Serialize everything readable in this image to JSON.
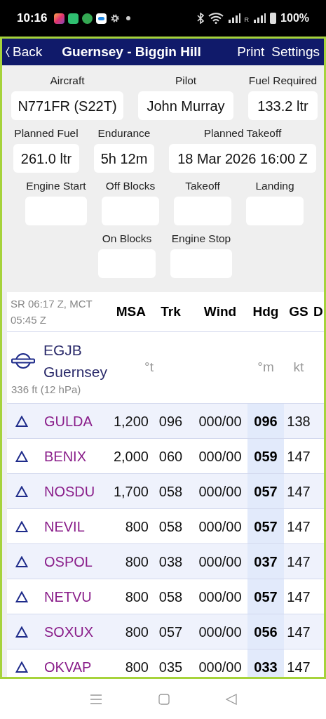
{
  "status_bar": {
    "time": "10:16",
    "roaming": "R",
    "battery": "100%"
  },
  "nav": {
    "back": "Back",
    "title": "Guernsey - Biggin Hill",
    "actions": [
      "Print",
      "Settings"
    ]
  },
  "field_rows": [
    [
      {
        "label": "Aircraft",
        "value": "N771FR (S22T)"
      },
      {
        "label": "Pilot",
        "value": "John Murray"
      },
      {
        "label": "Fuel Required",
        "value": "133.2 ltr"
      }
    ],
    [
      {
        "label": "Planned Fuel",
        "value": "261.0 ltr"
      },
      {
        "label": "Endurance",
        "value": "5h 12m"
      },
      {
        "label": "Planned Takeoff",
        "value": "18 Mar 2026 16:00 Z"
      }
    ],
    [
      {
        "label": "Engine Start"
      },
      {
        "label": "Off Blocks"
      },
      {
        "label": "Takeoff"
      },
      {
        "label": "Landing"
      }
    ],
    [
      {
        "label": "On Blocks"
      },
      {
        "label": "Engine Stop"
      }
    ]
  ],
  "table": {
    "info": "SR 06:17 Z, MCT 05:45 Z",
    "columns": [
      "MSA",
      "Trk",
      "Wind",
      "Hdg",
      "GS",
      "D"
    ],
    "departure": {
      "ident": "EGJB",
      "name": "Guernsey",
      "elevation": "336 ft (12 hPa)",
      "trk_unit": "°t",
      "hdg_unit": "°m",
      "gs_unit": "kt"
    },
    "rows": [
      {
        "name": "GULDA",
        "msa": "1,200",
        "trk": "096",
        "wind": "000/00",
        "hdg": "096",
        "gs": "138"
      },
      {
        "name": "BENIX",
        "msa": "2,000",
        "trk": "060",
        "wind": "000/00",
        "hdg": "059",
        "gs": "147"
      },
      {
        "name": "NOSDU",
        "msa": "1,700",
        "trk": "058",
        "wind": "000/00",
        "hdg": "057",
        "gs": "147"
      },
      {
        "name": "NEVIL",
        "msa": "800",
        "trk": "058",
        "wind": "000/00",
        "hdg": "057",
        "gs": "147"
      },
      {
        "name": "OSPOL",
        "msa": "800",
        "trk": "038",
        "wind": "000/00",
        "hdg": "037",
        "gs": "147"
      },
      {
        "name": "NETVU",
        "msa": "800",
        "trk": "058",
        "wind": "000/00",
        "hdg": "057",
        "gs": "147"
      },
      {
        "name": "SOXUX",
        "msa": "800",
        "trk": "057",
        "wind": "000/00",
        "hdg": "056",
        "gs": "147"
      },
      {
        "name": "OKVAP",
        "msa": "800",
        "trk": "035",
        "wind": "000/00",
        "hdg": "033",
        "gs": "147"
      }
    ]
  }
}
